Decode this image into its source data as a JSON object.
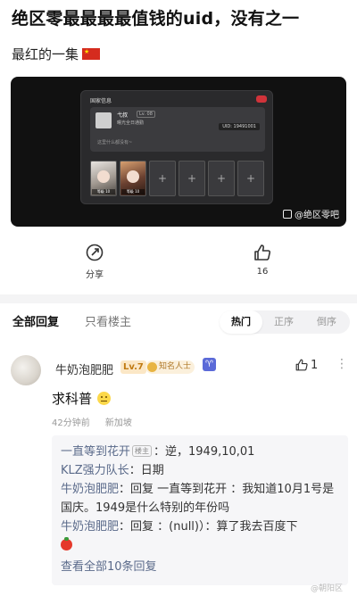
{
  "post": {
    "title": "绝区零最最最最值钱的uid，没有之一",
    "body": "最红的一集",
    "flag_icon": "china-flag-icon"
  },
  "screenshot": {
    "panel_title": "国家信息",
    "player_name": "弋叔",
    "level": "Lv. 08",
    "sub_label": "曙光全日通勤",
    "uid": "UID: 19491001",
    "signature": "这里什么都没有~",
    "agent1_tag": "等级 10",
    "agent2_tag": "等级 10",
    "empty_slot": "+",
    "watermark": "@绝区零吧"
  },
  "actions": {
    "share_label": "分享",
    "like_count": "16"
  },
  "filter": {
    "all_replies": "全部回复",
    "op_only": "只看楼主",
    "sort_hot": "热门",
    "sort_asc": "正序",
    "sort_desc": "倒序",
    "active_sort": "热门"
  },
  "comment": {
    "username": "牛奶泡肥肥",
    "level_badge": "Lv.7",
    "title_badge": "知名人士",
    "zodiac": "♈",
    "like_count": "1",
    "text": "求科普",
    "time": "42分钟前",
    "location": "新加坡"
  },
  "replies": [
    {
      "name": "一直等到花开",
      "op_tag": "楼主",
      "text": "：逆，1949,10,01"
    },
    {
      "name": "KLZ强力队长",
      "text": "：日期"
    },
    {
      "name": "牛奶泡肥肥",
      "text": "：回复 一直等到花开 ：我知道10月1号是国庆。1949是什么特别的年份吗"
    },
    {
      "name": "牛奶泡肥肥",
      "text": "：回复 ：(null)）：算了我去百度下"
    }
  ],
  "see_all": "查看全部10条回复",
  "colors": {
    "accent_blue": "#5a6a8a",
    "level_badge": "#c07a12",
    "zodiac_bg": "#5b6ad8"
  },
  "weibo_mark": "@朝阳区"
}
